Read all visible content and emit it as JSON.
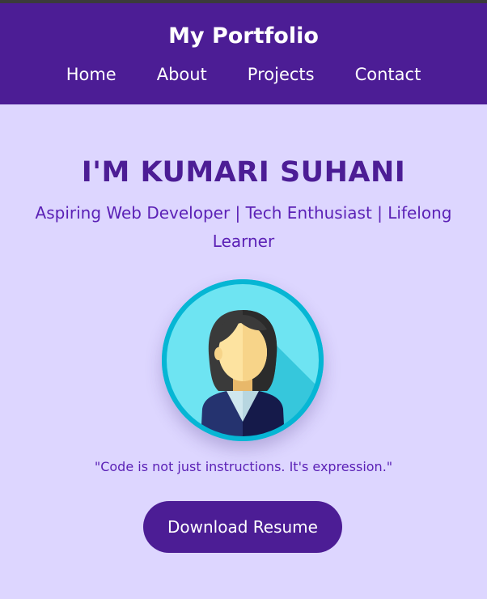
{
  "header": {
    "brand": "My Portfolio",
    "nav": [
      "Home",
      "About",
      "Projects",
      "Contact"
    ]
  },
  "hero": {
    "title": "I'M KUMARI SUHANI",
    "subtitle": "Aspiring Web Developer | Tech Enthusiast | Lifelong Learner",
    "avatar_icon": "female-avatar-icon",
    "quote": "\"Code is not just instructions. It's expression.\"",
    "cta_label": "Download Resume"
  },
  "colors": {
    "primary": "#4c1d95",
    "background": "#ddd6ff",
    "accent_text": "#5b21b6",
    "avatar_ring": "#06b6d4"
  }
}
